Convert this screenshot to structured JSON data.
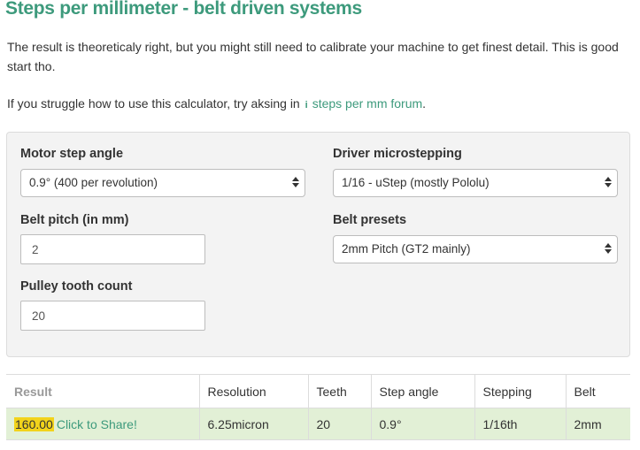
{
  "title": "Steps per millimeter - belt driven systems",
  "intro": "The result is theoreticaly right, but you might still need to calibrate your machine to get finest detail. This is good start tho.",
  "help": {
    "prefix": "If you struggle how to use this calculator, try aksing in",
    "icon": "info-icon",
    "link": "steps per mm forum",
    "suffix": "."
  },
  "form": {
    "motor_step_angle": {
      "label": "Motor step angle",
      "value": "0.9° (400 per revolution)"
    },
    "driver_microstepping": {
      "label": "Driver microstepping",
      "value": "1/16 - uStep (mostly Pololu)"
    },
    "belt_pitch": {
      "label": "Belt pitch (in mm)",
      "value": "2"
    },
    "belt_presets": {
      "label": "Belt presets",
      "value": "2mm Pitch (GT2 mainly)"
    },
    "pulley_tooth_count": {
      "label": "Pulley tooth count",
      "value": "20"
    }
  },
  "results": {
    "headers": [
      "Result",
      "Resolution",
      "Teeth",
      "Step angle",
      "Stepping",
      "Belt"
    ],
    "row": {
      "result": "160.00",
      "share": "Click to Share!",
      "resolution": "6.25micron",
      "teeth": "20",
      "step_angle": "0.9°",
      "stepping": "1/16th",
      "belt": "2mm"
    }
  },
  "colors": {
    "accent": "#3d9a7c",
    "result_row_bg": "#e2f0d6",
    "highlight": "#f2d31b",
    "panel_bg": "#f3f3f3"
  }
}
